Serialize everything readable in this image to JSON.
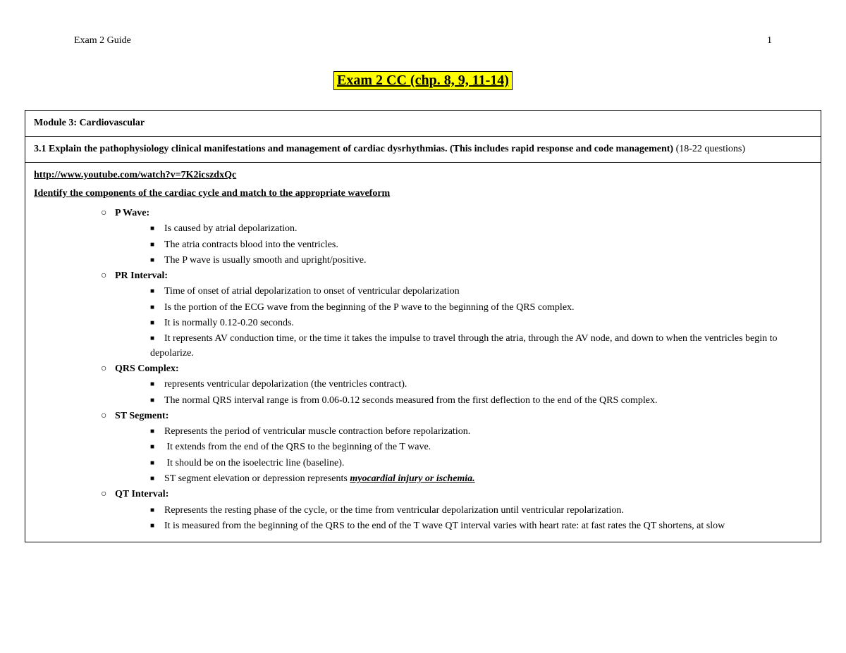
{
  "header": {
    "left": "Exam 2 Guide",
    "right": "1"
  },
  "title": "Exam 2 CC (chp. 8, 9, 11-14)",
  "module": "Module 3: Cardiovascular",
  "objective": {
    "bold": "3.1 Explain the pathophysiology clinical manifestations and management of cardiac dysrhythmias. (This includes rapid response and code management)",
    "plain": " (18-22 questions)"
  },
  "link": "http://www.youtube.com/watch?v=7K2icszdxQc",
  "section_heading": "Identify the components of the cardiac cycle and match to the appropriate waveform",
  "components": [
    {
      "label": "P Wave:",
      "items": [
        "Is caused by atrial depolarization.",
        "The atria contracts blood into the ventricles.",
        "The P wave is usually smooth and upright/positive."
      ]
    },
    {
      "label": "PR Interval:",
      "items": [
        "Time of onset of atrial depolarization to onset of ventricular depolarization",
        "Is the portion of the ECG wave from the beginning of the P wave to the beginning of the QRS complex.",
        "It is normally 0.12-0.20 seconds.",
        "It represents AV conduction time, or the time it takes the impulse to travel through the atria, through the AV node, and down to when the ventricles begin to depolarize."
      ]
    },
    {
      "label": "QRS Complex:",
      "items": [
        "represents ventricular depolarization (the ventricles contract).",
        "The normal QRS interval range is from 0.06-0.12 seconds measured from the first deflection to the end of the QRS complex."
      ]
    },
    {
      "label": "ST Segment:",
      "items": [
        "Represents the period of ventricular muscle contraction before repolarization.",
        " It extends from the end of the QRS to the beginning of the T wave.",
        " It should be on the isoelectric line (baseline).",
        {
          "prefix": "ST segment elevation or depression represents ",
          "emph": "myocardial injury or ischemia."
        }
      ]
    },
    {
      "label": "QT Interval:",
      "items": [
        "Represents the resting phase of the cycle, or the time from ventricular depolarization until ventricular repolarization.",
        "It is measured from the beginning of the QRS to the end of the T wave QT interval varies with heart rate: at fast rates the QT shortens, at slow"
      ]
    }
  ]
}
